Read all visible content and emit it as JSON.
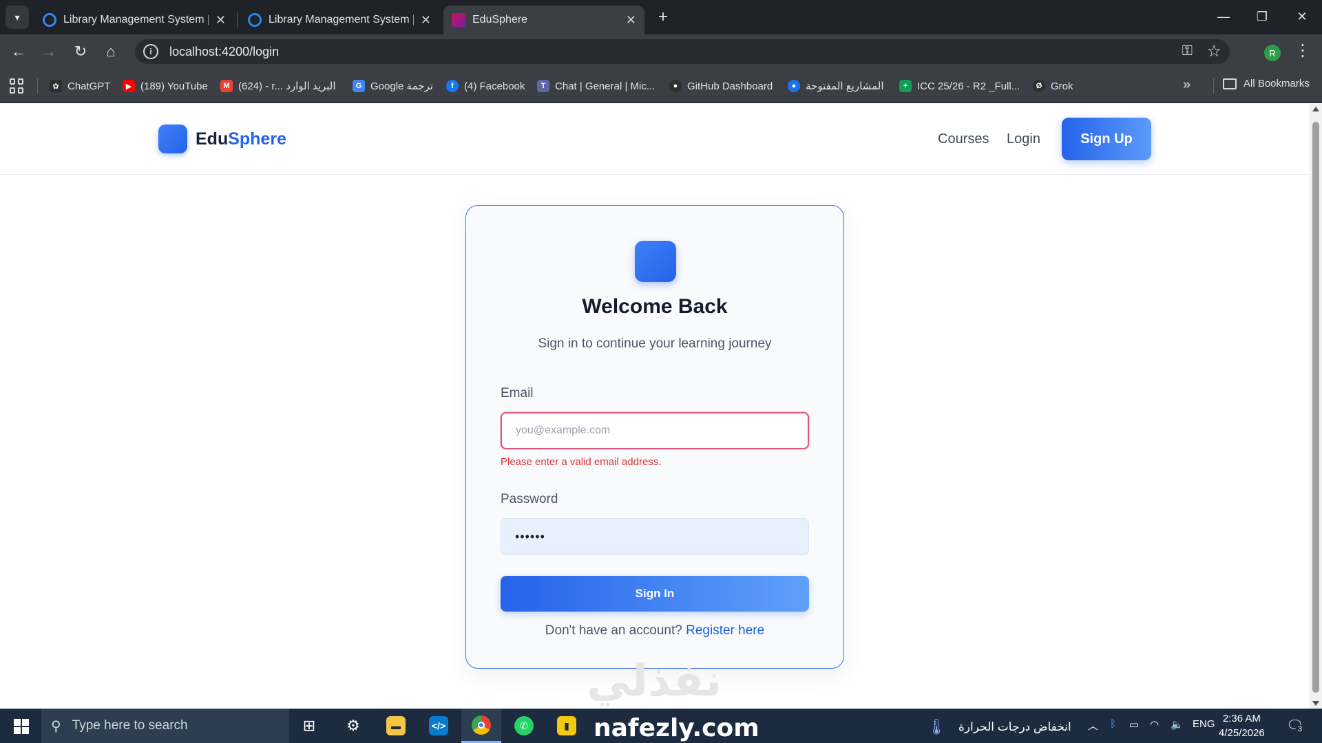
{
  "browser": {
    "tabs": [
      {
        "title": "Library Management System | ...",
        "favicon_color": "#3b82f6",
        "active": false
      },
      {
        "title": "Library Management System | ...",
        "favicon_color": "#1e88e5",
        "active": false
      },
      {
        "title": "EduSphere",
        "favicon_color": "#c2185b",
        "active": true
      }
    ],
    "new_tab_label": "+",
    "url": "localhost:4200/login",
    "profile_initial": "R",
    "bookmarks": [
      {
        "label": "ChatGPT",
        "color": "#2f2f2f",
        "glyph": "✿"
      },
      {
        "label": "(189) YouTube",
        "color": "#ff0000",
        "glyph": "▶"
      },
      {
        "label": "(624) - r... البريد الوارد",
        "color": "#ea4335",
        "glyph": "M"
      },
      {
        "label": "Google ترجمة",
        "color": "#4285f4",
        "glyph": "G"
      },
      {
        "label": "(4) Facebook",
        "color": "#1877f2",
        "glyph": "f"
      },
      {
        "label": "Chat | General | Mic...",
        "color": "#6264a7",
        "glyph": "T"
      },
      {
        "label": "GitHub Dashboard",
        "color": "#2f2f2f",
        "glyph": "●"
      },
      {
        "label": "المشاريع المفتوحة",
        "color": "#1a73e8",
        "glyph": "●"
      },
      {
        "label": "ICC 25/26 - R2 _Full...",
        "color": "#0f9d58",
        "glyph": "+"
      },
      {
        "label": "Grok",
        "color": "#2f2f2f",
        "glyph": "Ø"
      }
    ],
    "all_bookmarks_label": "All Bookmarks"
  },
  "site": {
    "brand_part1": "Edu",
    "brand_part2": "Sphere",
    "nav": {
      "courses": "Courses",
      "login": "Login",
      "signup": "Sign Up"
    }
  },
  "login": {
    "title": "Welcome Back",
    "subtitle": "Sign in to continue your learning journey",
    "email_label": "Email",
    "email_placeholder": "you@example.com",
    "email_error": "Please enter a valid email address.",
    "password_label": "Password",
    "password_value": "••••••",
    "submit_label": "Sign In",
    "register_prompt": "Don't have an account?",
    "register_link": "Register here"
  },
  "watermark": {
    "arabic": "نفذلي",
    "latin": "nafezly.com"
  },
  "taskbar": {
    "search_placeholder": "Type here to search",
    "weather_text": "انخفاض درجات الحرارة",
    "language": "ENG",
    "time": "2:36 AM",
    "date": "4/25/2026",
    "notification_count": "3"
  },
  "colors": {
    "accent": "#2563eb",
    "error": "#d63434"
  }
}
